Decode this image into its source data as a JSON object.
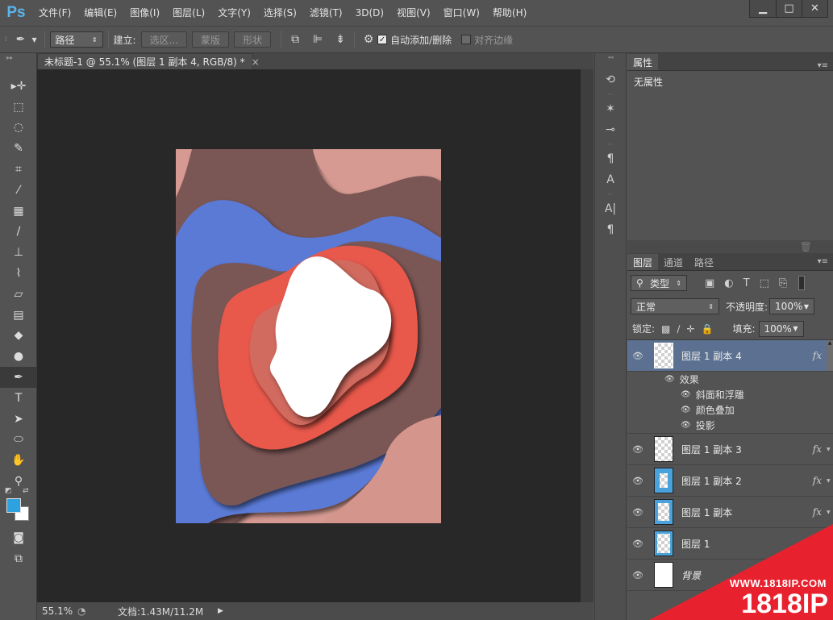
{
  "app": {
    "logo": "Ps"
  },
  "menu": [
    "文件(F)",
    "编辑(E)",
    "图像(I)",
    "图层(L)",
    "文字(Y)",
    "选择(S)",
    "滤镜(T)",
    "3D(D)",
    "视图(V)",
    "窗口(W)",
    "帮助(H)"
  ],
  "window_controls": {
    "minimize": "▁",
    "maximize": "□",
    "close": "✕"
  },
  "options": {
    "mode_select": "路径",
    "make_label": "建立:",
    "selection_btn": "选区...",
    "mask_btn": "蒙版",
    "shape_btn": "形状",
    "auto_add_label": "自动添加/删除",
    "auto_add_checked": true,
    "align_edges_label": "对齐边缘",
    "align_edges_checked": false
  },
  "document": {
    "tab_title": "未标题-1 @ 55.1% (图层 1 副本 4, RGB/8) *",
    "tab_close": "×"
  },
  "status": {
    "zoom": "55.1%",
    "doc_info": "文档:1.43M/11.2M"
  },
  "colors": {
    "foreground": "#2ea2e0",
    "background": "#ffffff"
  },
  "properties": {
    "tab": "属性",
    "empty_text": "无属性"
  },
  "layers_panel": {
    "tabs": [
      "图层",
      "通道",
      "路径"
    ],
    "filter_kind": "类型",
    "blend_mode": "正常",
    "opacity_label": "不透明度:",
    "opacity_value": "100%",
    "lock_label": "锁定:",
    "fill_label": "填充:",
    "fill_value": "100%",
    "effects_label": "效果",
    "effects": [
      "斜面和浮雕",
      "颜色叠加",
      "投影"
    ],
    "layers": [
      {
        "name": "图层 1 副本 4",
        "fx": "fx",
        "selected": true
      },
      {
        "name": "图层 1 副本 3",
        "fx": "fx"
      },
      {
        "name": "图层 1 副本 2",
        "fx": "fx"
      },
      {
        "name": "图层 1 副本",
        "fx": "fx"
      },
      {
        "name": "图层 1",
        "fx": "f"
      },
      {
        "name": "背景",
        "fx": ""
      }
    ]
  },
  "watermark": {
    "url": "WWW.1818IP.COM",
    "brand": "1818IP"
  }
}
